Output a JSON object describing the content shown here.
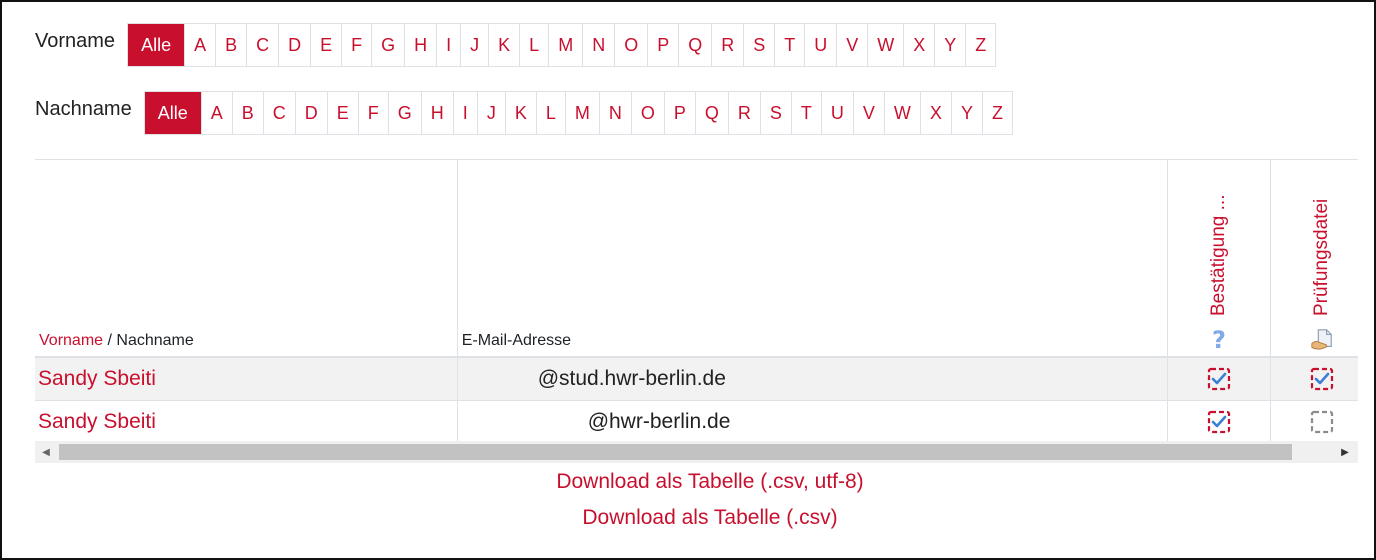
{
  "filters": {
    "firstname": {
      "label": "Vorname",
      "active": "Alle",
      "letters": [
        "Alle",
        "A",
        "B",
        "C",
        "D",
        "E",
        "F",
        "G",
        "H",
        "I",
        "J",
        "K",
        "L",
        "M",
        "N",
        "O",
        "P",
        "Q",
        "R",
        "S",
        "T",
        "U",
        "V",
        "W",
        "X",
        "Y",
        "Z"
      ]
    },
    "lastname": {
      "label": "Nachname",
      "active": "Alle",
      "letters": [
        "Alle",
        "A",
        "B",
        "C",
        "D",
        "E",
        "F",
        "G",
        "H",
        "I",
        "J",
        "K",
        "L",
        "M",
        "N",
        "O",
        "P",
        "Q",
        "R",
        "S",
        "T",
        "U",
        "V",
        "W",
        "X",
        "Y",
        "Z"
      ]
    }
  },
  "table": {
    "headers": {
      "firstname": "Vorname",
      "separator": " / ",
      "lastname": "Nachname",
      "email": "E-Mail-Adresse",
      "col_confirmation": "Bestätigung ...",
      "col_examfile": "Prüfungsdatei",
      "col_confirmation_icon": "question-mark-icon",
      "col_examfile_icon": "file-icon"
    },
    "rows": [
      {
        "name": "Sandy Sbeiti",
        "email": "@stud.hwr-berlin.de",
        "confirmation": true,
        "examfile": true
      },
      {
        "name": "Sandy Sbeiti",
        "email": "@hwr-berlin.de",
        "confirmation": true,
        "examfile": false
      }
    ]
  },
  "downloads": {
    "csv_utf8": "Download als Tabelle (.csv, utf-8)",
    "csv": "Download als Tabelle (.csv)"
  },
  "colors": {
    "accent": "#c8102e",
    "checkbox_blue": "#3a7fd5"
  }
}
